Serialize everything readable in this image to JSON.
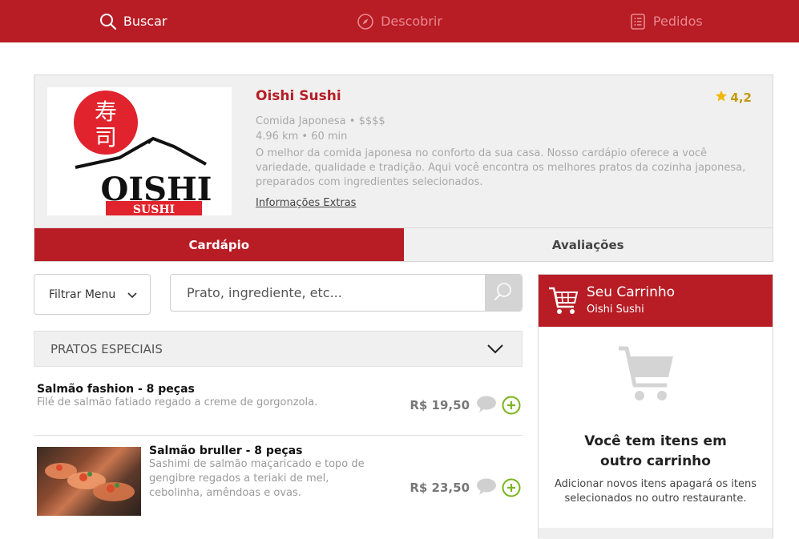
{
  "nav": {
    "items": [
      {
        "label": "Buscar",
        "icon": "search-icon",
        "active": true
      },
      {
        "label": "Descobrir",
        "icon": "compass-icon",
        "active": false
      },
      {
        "label": "Pedidos",
        "icon": "receipt-icon",
        "active": false
      }
    ]
  },
  "restaurant": {
    "name": "Oishi Sushi",
    "rating": "4,2",
    "category": "Comida Japonesa • $$$$",
    "distance_time": "4.96 km • 60 min",
    "description": "O melhor da comida japonesa no conforto da sua casa. Nosso cardápio oferece a você variedade, qualidade e tradição. Aqui você encontra os melhores pratos da cozinha japonesa, preparados com ingredientes selecionados.",
    "extra_info_link": "Informações Extras",
    "logo": {
      "kanji_top": "寿",
      "kanji_bottom": "司",
      "word": "OISHI",
      "subword": "SUSHI"
    }
  },
  "tabs": [
    {
      "label": "Cardápio",
      "active": true
    },
    {
      "label": "Avaliações",
      "active": false
    }
  ],
  "filter": {
    "label": "Filtrar Menu"
  },
  "search": {
    "placeholder": "Prato, ingrediente, etc..."
  },
  "category": {
    "title": "PRATOS ESPECIAIS"
  },
  "menu_items": [
    {
      "name": "Salmão fashion - 8 peças",
      "description": "Filé de salmão fatiado regado a creme de gorgonzola.",
      "price": "R$ 19,50"
    },
    {
      "name": "Salmão bruller - 8 peças",
      "description": "Sashimi de salmão maçaricado e topo de gengibre regados a teriaki de mel, cebolinha, amêndoas e ovas.",
      "price": "R$ 23,50"
    }
  ],
  "cart": {
    "title": "Seu Carrinho",
    "restaurant": "Oishi Sushi",
    "message": "Você tem itens em outro carrinho",
    "submessage": "Adicionar novos itens apagará os itens selecionados no outro restaurante."
  },
  "colors": {
    "brand": "#b81c25",
    "accent_green": "#7ab51d",
    "rating": "#f2b705"
  }
}
